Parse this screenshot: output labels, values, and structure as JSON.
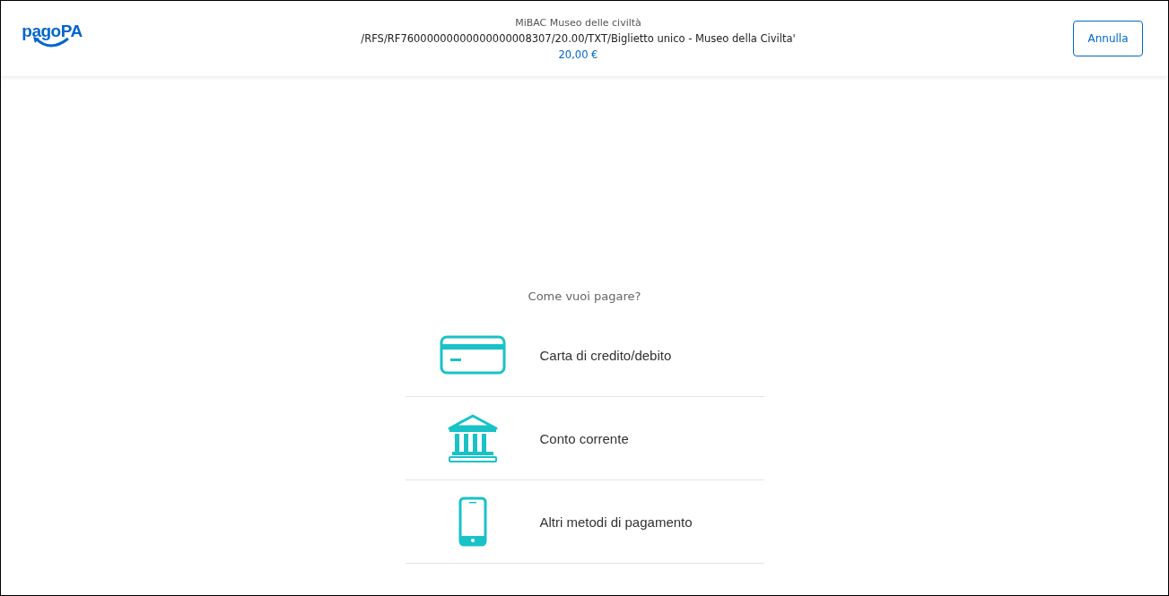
{
  "header": {
    "logo": "pagoPA",
    "merchant": "MiBAC Museo delle civiltà",
    "causale": "/RFS/RF76000000000000000008307/20.00/TXT/Biglietto unico - Museo della Civilta'",
    "amount": "20,00 €",
    "cancel_button": "Annulla"
  },
  "question": "Come vuoi pagare?",
  "methods": [
    {
      "kind": "card",
      "label": "Carta di credito/debito"
    },
    {
      "kind": "bank",
      "label": "Conto corrente"
    },
    {
      "kind": "phone",
      "label": "Altri metodi di pagamento"
    }
  ]
}
